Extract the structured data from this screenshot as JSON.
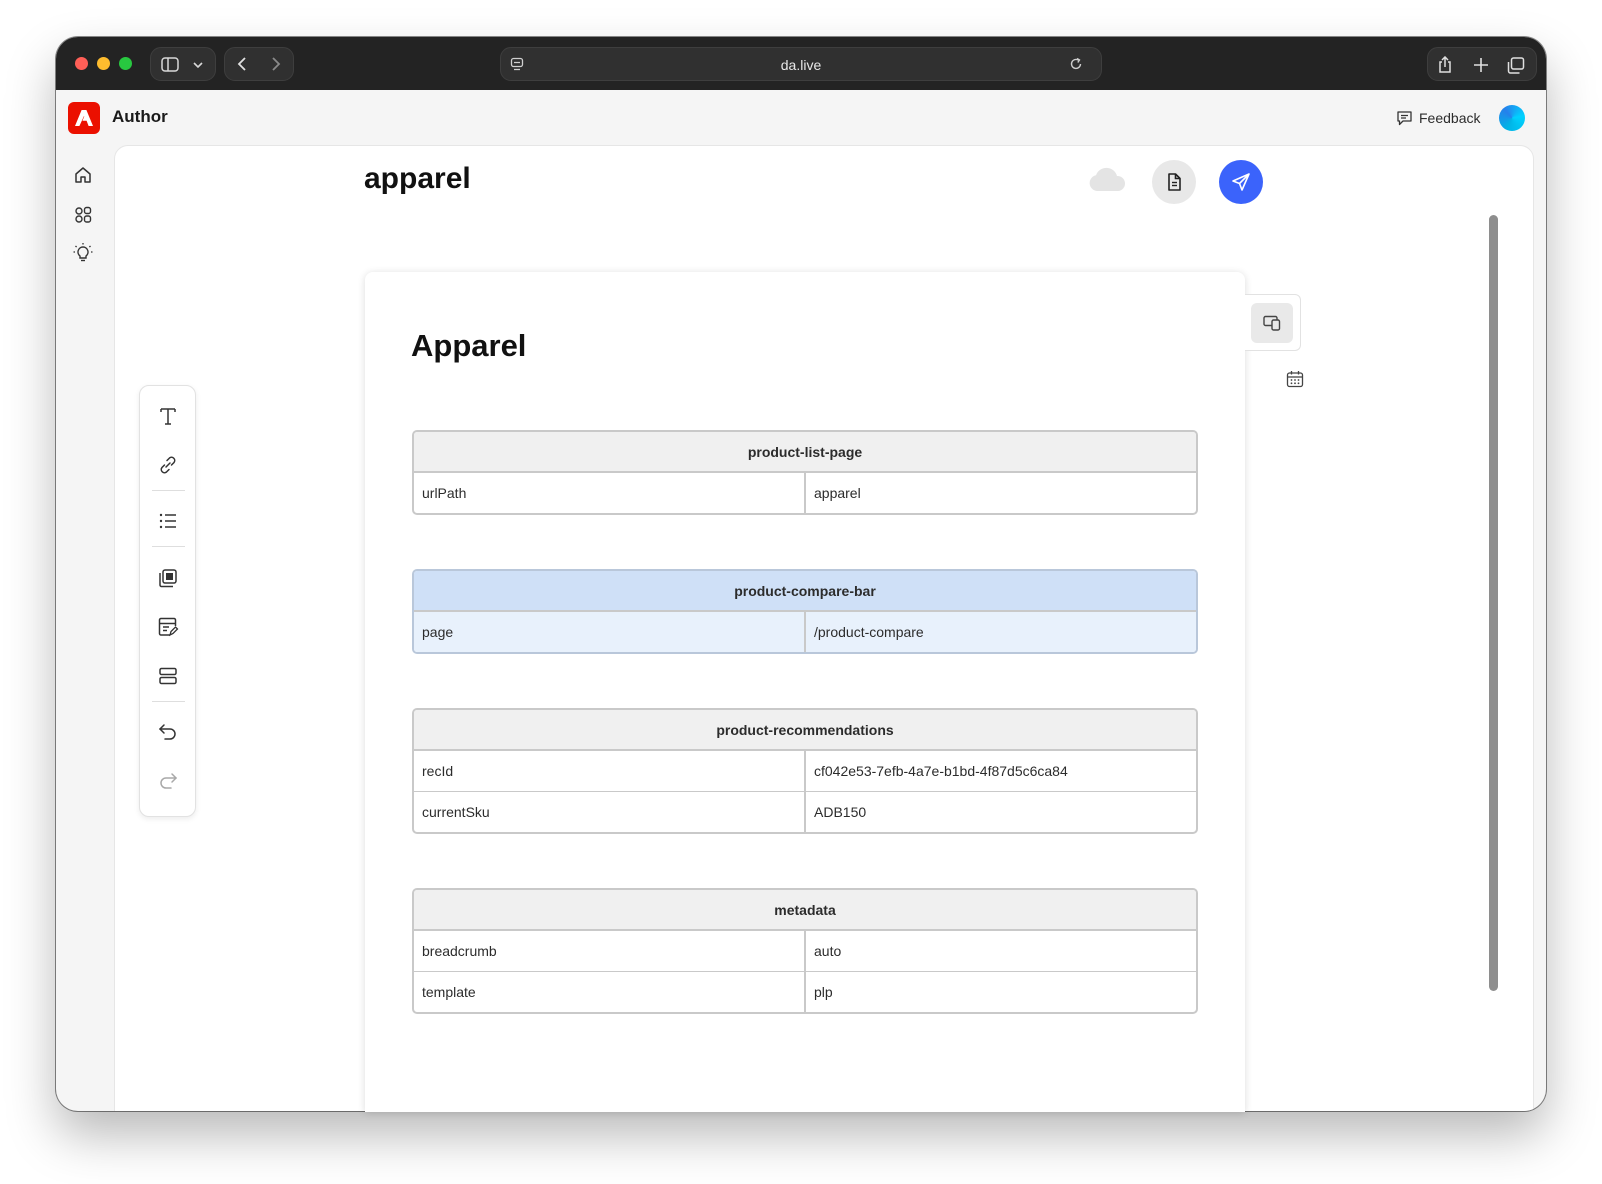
{
  "browser": {
    "url": "da.live"
  },
  "app": {
    "brand": "Author",
    "feedback_label": "Feedback"
  },
  "document": {
    "title": "apparel",
    "heading": "Apparel",
    "blocks": [
      {
        "name": "product-list-page",
        "selected": false,
        "rows": [
          [
            "urlPath",
            "apparel"
          ]
        ]
      },
      {
        "name": "product-compare-bar",
        "selected": true,
        "rows": [
          [
            "page",
            "/product-compare"
          ]
        ]
      },
      {
        "name": "product-recommendations",
        "selected": false,
        "rows": [
          [
            "recId",
            "cf042e53-7efb-4a7e-b1bd-4f87d5c6ca84"
          ],
          [
            "currentSku",
            "ADB150"
          ]
        ]
      },
      {
        "name": "metadata",
        "selected": false,
        "rows": [
          [
            "breadcrumb",
            "auto"
          ],
          [
            "template",
            "plp"
          ]
        ]
      }
    ]
  },
  "icons": {
    "nav": [
      "home-icon",
      "apps-icon",
      "lightbulb-icon"
    ],
    "toolbar": [
      "text-icon",
      "link-icon",
      "list-icon",
      "library-icon",
      "form-icon",
      "blocks-icon",
      "undo-icon",
      "redo-icon"
    ],
    "header": [
      "cloud-icon",
      "file-icon",
      "send-icon"
    ],
    "side": [
      "preview-icon",
      "calendar-icon"
    ]
  },
  "colors": {
    "accent": "#3b63fb",
    "adobe_red": "#eb1000",
    "selected_block": "#cfe0f7"
  }
}
